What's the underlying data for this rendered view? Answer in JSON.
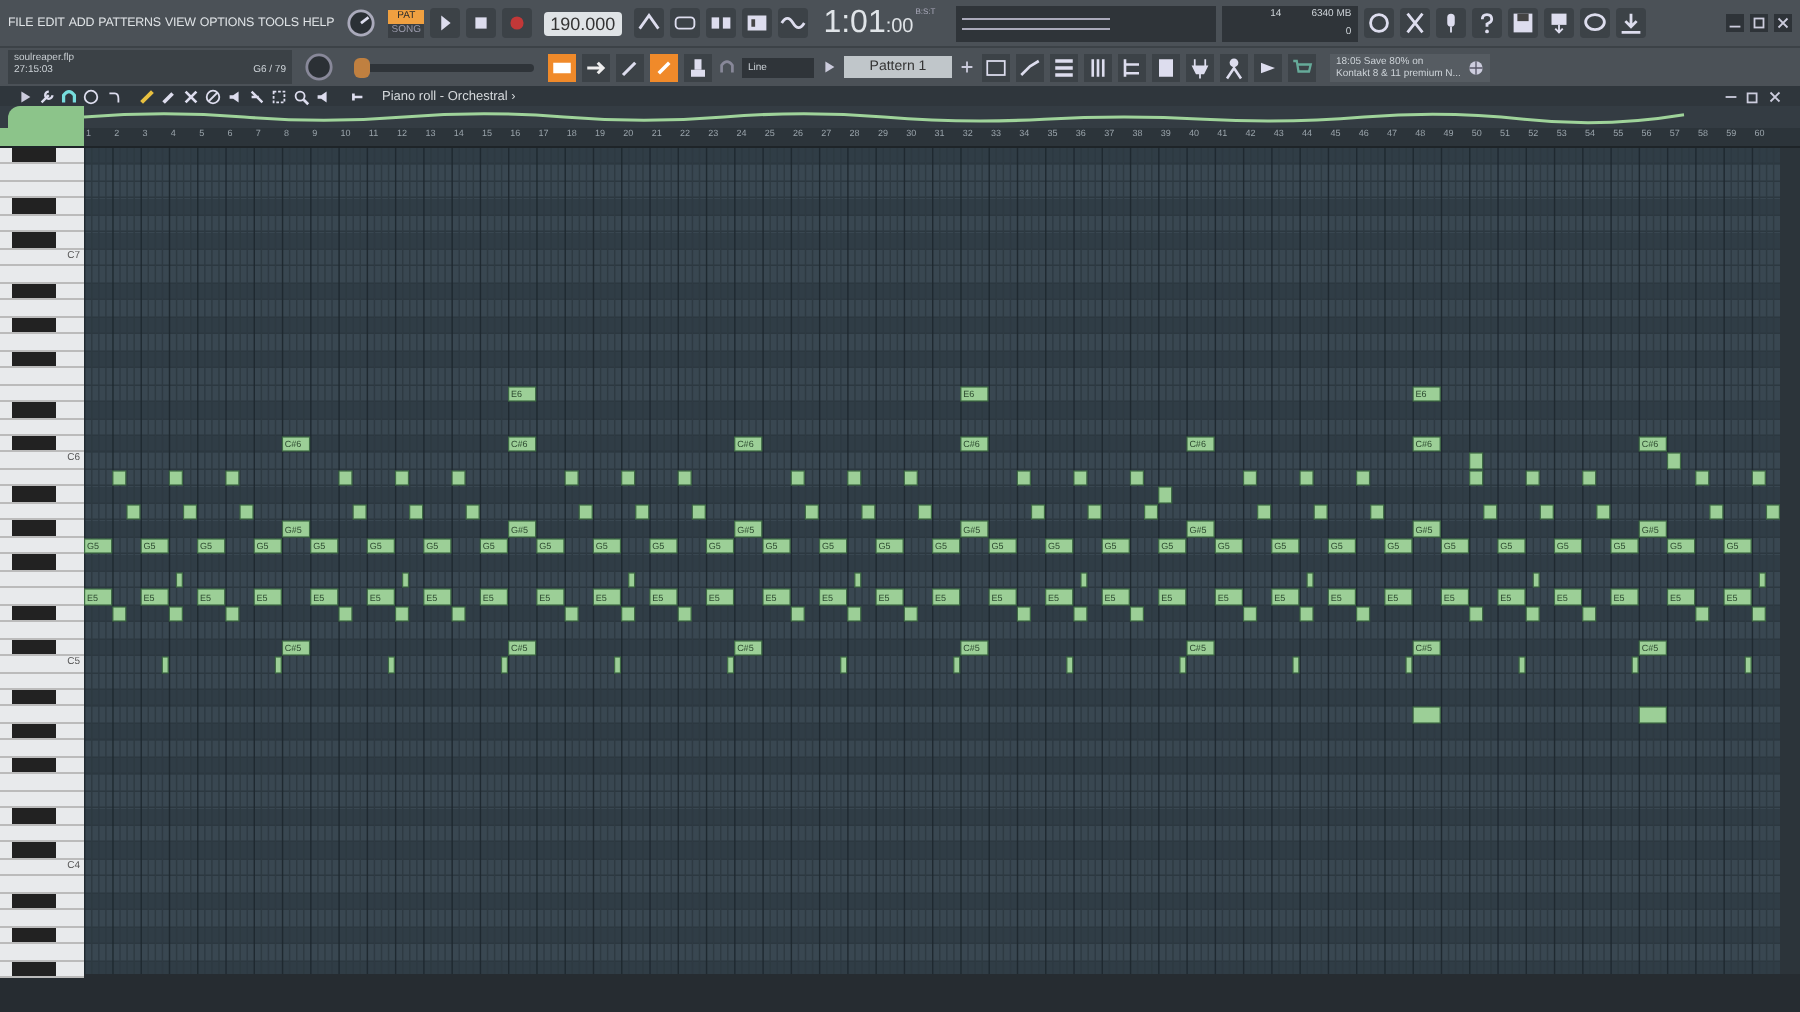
{
  "menu": [
    "FILE",
    "EDIT",
    "ADD",
    "PATTERNS",
    "VIEW",
    "OPTIONS",
    "TOOLS",
    "HELP"
  ],
  "song": {
    "file": "soulreaper.flp",
    "time": "27:15:03",
    "key_info": "G6 / 79"
  },
  "transport": {
    "modes": [
      {
        "label": "PAT",
        "selected": true
      },
      {
        "label": "SONG",
        "selected": false
      }
    ],
    "recording": false
  },
  "tempo": "190.000",
  "clock": {
    "main": "1:01",
    "sub": ":00",
    "unit": "B:S:T"
  },
  "cpu": {
    "polyphony": "14",
    "memory": "6340 MB",
    "voices": "0"
  },
  "pitch_slider": {
    "level": 0.0
  },
  "snap": "Line",
  "pattern": "Pattern 1",
  "news": {
    "time": "18:05",
    "line1": "Save 80% on",
    "line2": "Kontakt 8 & 11 premium N..."
  },
  "piano_roll": {
    "title": "Piano roll - Orchestral",
    "arrow": "›"
  },
  "ruler": [
    "1",
    "2",
    "3",
    "4",
    "5",
    "6",
    "7",
    "8",
    "9",
    "10",
    "11",
    "12",
    "13",
    "14",
    "15",
    "16",
    "17",
    "18",
    "19",
    "20",
    "21",
    "22",
    "23",
    "24",
    "25",
    "26",
    "27",
    "28",
    "29",
    "30",
    "31",
    "32",
    "33",
    "34",
    "35",
    "36",
    "37",
    "38",
    "39",
    "40",
    "41",
    "42",
    "43",
    "44",
    "45",
    "46",
    "47",
    "48",
    "49",
    "50",
    "51",
    "52",
    "53",
    "54",
    "55",
    "56",
    "57",
    "58",
    "59",
    "60"
  ],
  "octaves": [
    "C7",
    "C6",
    "C5",
    "C4"
  ],
  "note_labels": [
    "G5",
    "E5",
    "G5",
    "E5",
    "G5",
    "E5",
    "G5",
    "E5",
    "C#6",
    "G#5",
    "C#5",
    "G5",
    "E5",
    "G5",
    "E5",
    "G5",
    "E5",
    "G5",
    "E5",
    "E6",
    "C#6",
    "G#5",
    "C#5",
    "G5",
    "E5",
    "G5",
    "E5",
    "G5",
    "E5",
    "G5",
    "E5",
    "C#6",
    "G#5",
    "C#5",
    "G5",
    "E5",
    "G5",
    "E5",
    "G5",
    "E5",
    "G5",
    "E5",
    "E6",
    "C#6",
    "G#5",
    "C#5",
    "G5",
    "E5",
    "G5",
    "E5",
    "G5",
    "E5",
    "G5",
    "E5",
    "C#6",
    "G#5",
    "C#5",
    "G5",
    "E5",
    "G5",
    "E5",
    "G5",
    "E5",
    "G5",
    "E5",
    "E6",
    "C#6",
    "G#5",
    "C#5",
    "G5",
    "E5",
    "G5",
    "E5",
    "G5",
    "E5",
    "G5",
    "E5",
    "C#6",
    "G#5",
    "C#5",
    "G5",
    "E5",
    "G5",
    "E5"
  ]
}
